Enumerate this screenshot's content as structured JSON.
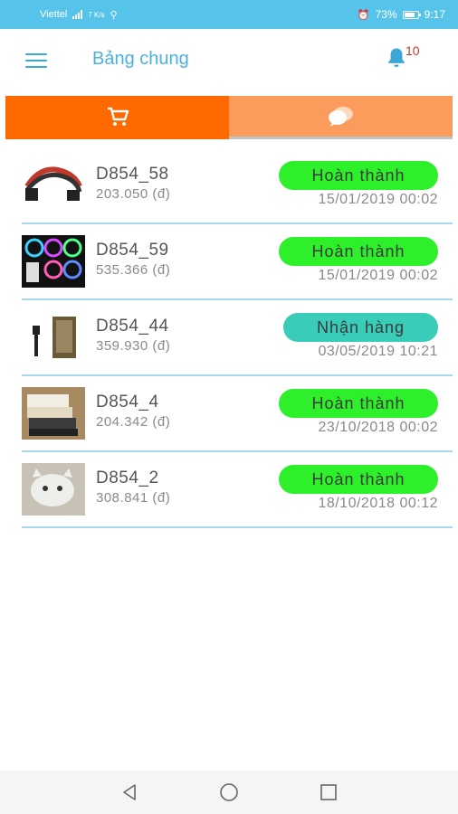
{
  "status_bar": {
    "carrier": "Viettel",
    "network_speed": "7 K/s",
    "battery_percent": "73%",
    "time": "9:17"
  },
  "header": {
    "title": "Bảng chung",
    "notification_count": "10"
  },
  "tabs": [
    {
      "icon": "cart-icon",
      "active": true
    },
    {
      "icon": "chat-icon",
      "active": false
    }
  ],
  "orders": [
    {
      "code": "D854_58",
      "amount": "203.050 (đ)",
      "status": "Hoàn thành",
      "date": "15/01/2019 00:02"
    },
    {
      "code": "D854_59",
      "amount": "535.366 (đ)",
      "status": "Hoàn thành",
      "date": "15/01/2019 00:02"
    },
    {
      "code": "D854_44",
      "amount": "359.930 (đ)",
      "status": "Nhận hàng",
      "date": "03/05/2019 10:21"
    },
    {
      "code": "D854_4",
      "amount": "204.342 (đ)",
      "status": "Hoàn thành",
      "date": "23/10/2018 00:02"
    },
    {
      "code": "D854_2",
      "amount": "308.841 (đ)",
      "status": "Hoàn thành",
      "date": "18/10/2018 00:12"
    }
  ],
  "colors": {
    "status_bar": "#56c4ea",
    "accent_blue": "#4bb2de",
    "tab_active": "#ff6a00",
    "tab_inactive": "#fb9c5c",
    "status_done": "#2ef02a",
    "status_receive": "#39cdb9"
  }
}
